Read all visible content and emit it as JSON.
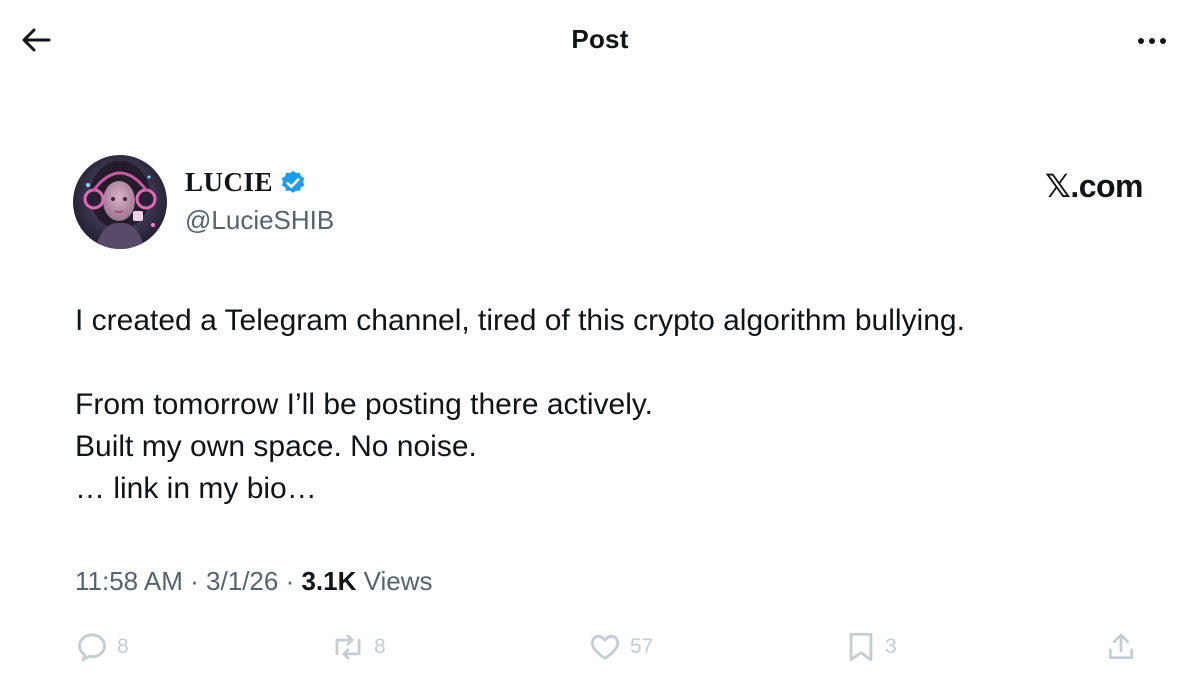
{
  "header": {
    "title": "Post",
    "back_icon": "arrow-left-icon",
    "more_icon": "more-horizontal-icon"
  },
  "author": {
    "display_name": "LUCIE",
    "handle": "@LucieSHIB",
    "verified_icon": "verified-badge-icon",
    "verified_color": "#1d9bf0",
    "brand": "𝕏.com"
  },
  "post": {
    "lines": [
      "I created a Telegram channel, tired of this crypto algorithm bullying.",
      "From tomorrow I’ll be posting there actively.",
      "Built my own space. No noise.",
      "… link in my bio…"
    ]
  },
  "meta": {
    "time": "11:58 AM",
    "separator": " · ",
    "date": "3/1/26",
    "views_count": "3.1K",
    "views_label": "Views"
  },
  "actions": {
    "replies": "8",
    "reposts": "8",
    "likes": "57",
    "bookmarks": "3",
    "reply_icon": "reply-icon",
    "repost_icon": "repost-icon",
    "like_icon": "heart-icon",
    "bookmark_icon": "bookmark-icon",
    "share_icon": "share-icon"
  },
  "colors": {
    "text": "#0f1419",
    "secondary": "#536471",
    "faded_action": "#c3cdd4"
  }
}
